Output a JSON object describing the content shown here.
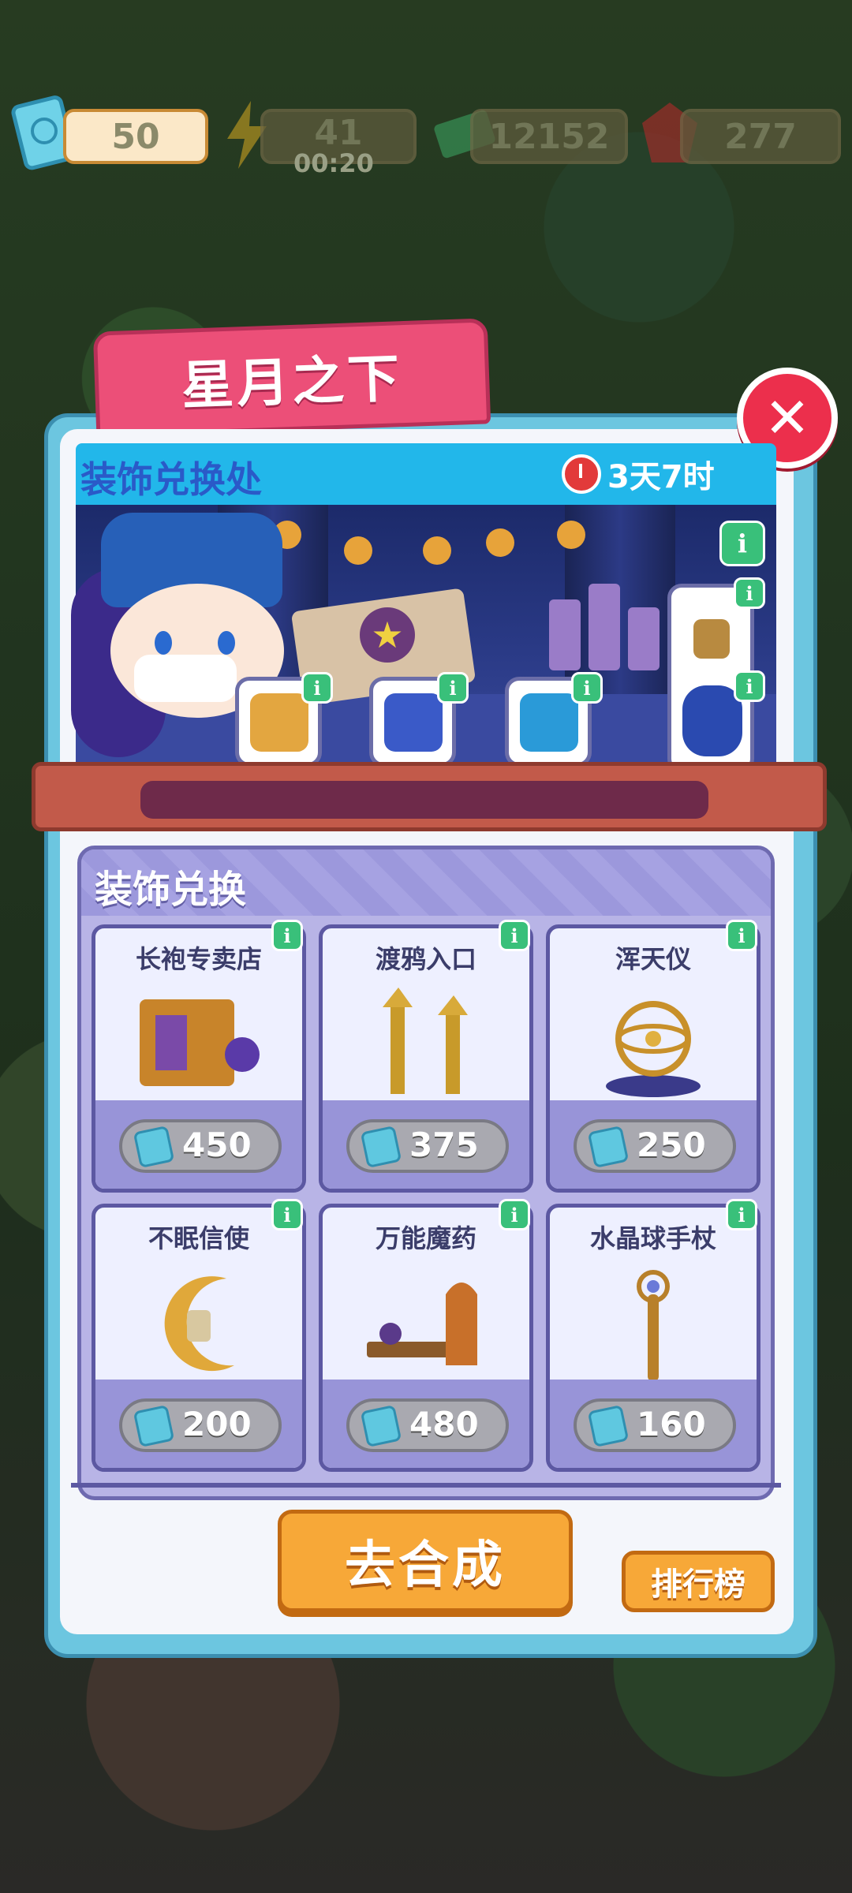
{
  "resources": [
    {
      "icon": "ticket-icon",
      "value": "50"
    },
    {
      "icon": "energy-icon",
      "value": "41",
      "sub": "00:20"
    },
    {
      "icon": "cash-icon",
      "value": "12152"
    },
    {
      "icon": "gem-icon",
      "value": "277"
    }
  ],
  "event": {
    "title": "星月之下",
    "banner_title": "装饰兑换处",
    "timer": "3天7时",
    "close_icon": "close-icon"
  },
  "rewards": [
    {
      "icon": "treasure-chest-icon",
      "color": "#e3a640"
    },
    {
      "icon": "paint-brush-icon",
      "color": "#3a5ac8"
    },
    {
      "icon": "jeweled-chest-icon",
      "color": "#2a9ad8"
    },
    {
      "icon": "potion-icon",
      "color": "#b88a40"
    },
    {
      "icon": "wizard-figure-icon",
      "color": "#2a4ab0"
    }
  ],
  "exchange": {
    "title": "装饰兑换",
    "items": [
      {
        "name": "长袍专卖店",
        "price": "450",
        "icon": "robe-shop-icon"
      },
      {
        "name": "渡鸦入口",
        "price": "375",
        "icon": "raven-gate-icon"
      },
      {
        "name": "浑天仪",
        "price": "250",
        "icon": "armillary-sphere-icon"
      },
      {
        "name": "不眠信使",
        "price": "200",
        "icon": "moon-messenger-icon"
      },
      {
        "name": "万能魔药",
        "price": "480",
        "icon": "potion-bench-icon"
      },
      {
        "name": "水晶球手杖",
        "price": "160",
        "icon": "crystal-staff-icon"
      }
    ]
  },
  "buttons": {
    "merge": "去合成",
    "ranking": "排行榜"
  },
  "colors": {
    "accent_pink": "#ec4f78",
    "panel_blue": "#6cc6e0",
    "button_orange": "#f7a838",
    "info_green": "#39c07a"
  }
}
